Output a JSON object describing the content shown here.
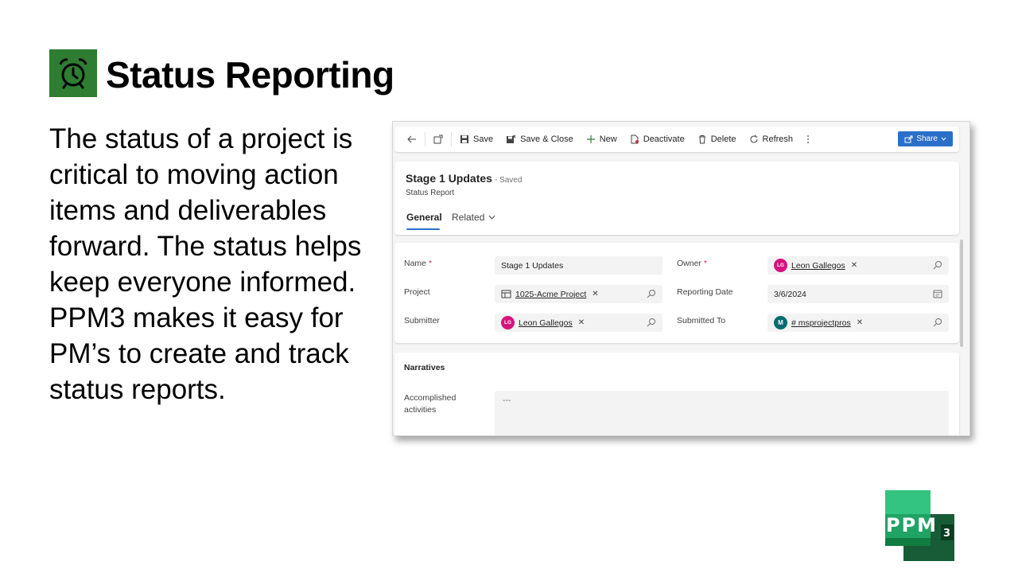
{
  "slide": {
    "title": "Status Reporting",
    "body": "The status of a project is critical to moving action items and deliverables forward. The status helps keep everyone informed. PPM3 makes it easy for PM’s to create and track status reports.",
    "title_icon": "alarm-clock-icon",
    "accent_color": "#2e7d32"
  },
  "toolbar": {
    "save": "Save",
    "save_close": "Save & Close",
    "new": "New",
    "deactivate": "Deactivate",
    "delete": "Delete",
    "refresh": "Refresh",
    "share": "Share"
  },
  "record": {
    "title": "Stage 1 Updates",
    "saved": "- Saved",
    "type": "Status Report",
    "tabs": [
      "General",
      "Related"
    ]
  },
  "form": {
    "name_label": "Name",
    "name_value": "Stage 1 Updates",
    "owner_label": "Owner",
    "owner_value": "Leon Gallegos",
    "owner_initials": "LG",
    "project_label": "Project",
    "project_value": "1025-Acme Project",
    "reporting_date_label": "Reporting Date",
    "reporting_date_value": "3/6/2024",
    "submitter_label": "Submitter",
    "submitter_value": "Leon Gallegos",
    "submitter_initials": "LG",
    "submitted_to_label": "Submitted To",
    "submitted_to_value": "# msprojectpros",
    "submitted_to_initials": "M",
    "required_mark": "*"
  },
  "narratives": {
    "title": "Narratives",
    "accomplished_label": "Accomplished activities",
    "accomplished_value": "---"
  },
  "logo": {
    "text": "PPM",
    "superscript": "3",
    "color": "#1e7b45"
  }
}
